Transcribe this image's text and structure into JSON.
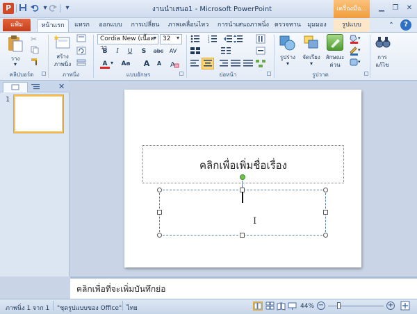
{
  "titlebar": {
    "title": "งานนำเสนอ1 - Microsoft PowerPoint",
    "logo_letter": "P",
    "context_tab_header": "เครื่องมือ...",
    "qat_icons": [
      "save-icon",
      "undo-icon",
      "redo-icon",
      "customize-icon"
    ],
    "window_buttons": [
      "minimize",
      "maximize",
      "close"
    ]
  },
  "tabs": {
    "file": "แฟ้ม",
    "items": [
      "หน้าแรก",
      "แทรก",
      "ออกแบบ",
      "การเปลี่ยน",
      "ภาพเคลื่อนไหว",
      "การนำเสนอภาพนิ่ง",
      "ตรวจทาน",
      "มุมมอง",
      "รูปแบบ"
    ],
    "active": "หน้าแรก",
    "context": "รูปแบบ"
  },
  "ribbon": {
    "clipboard": {
      "paste": "วาง",
      "group": "คลิปบอร์ด"
    },
    "slides": {
      "new_slide": "สร้าง",
      "new_slide_line2": "ภาพนิ่ง",
      "group": "ภาพนิ่ง"
    },
    "font": {
      "font_name": "Cordia New (เนื้อควา",
      "font_size": "32",
      "bold": "B",
      "italic": "I",
      "underline": "U",
      "shadow": "S",
      "strike": "abc",
      "spacing": "AV",
      "color": "A",
      "case": "Aa",
      "grow": "A",
      "shrink": "A",
      "group": "แบบอักษร"
    },
    "paragraph": {
      "group": "ย่อหน้า"
    },
    "drawing": {
      "shapes": "รูปร่าง",
      "arrange": "จัดเรียง",
      "quick_styles": "ลักษณะ",
      "quick_styles_line2": "ด่วน",
      "group": "รูปวาด"
    },
    "editing": {
      "find": "การ",
      "find_line2": "แก้ไข"
    }
  },
  "left_pane": {
    "slide_number": "1"
  },
  "slide": {
    "title_placeholder": "คลิกเพื่อเพิ่มชื่อเรื่อง"
  },
  "notes": {
    "placeholder": "คลิกเพื่อที่จะเพิ่มบันทึกย่อ"
  },
  "statusbar": {
    "slide_info": "ภาพนิ่ง 1 จาก 1",
    "theme": "\"ชุดรูปแบบของ Office\"",
    "language": "ไทย",
    "zoom": "44%",
    "zoom_level": 0.44
  }
}
